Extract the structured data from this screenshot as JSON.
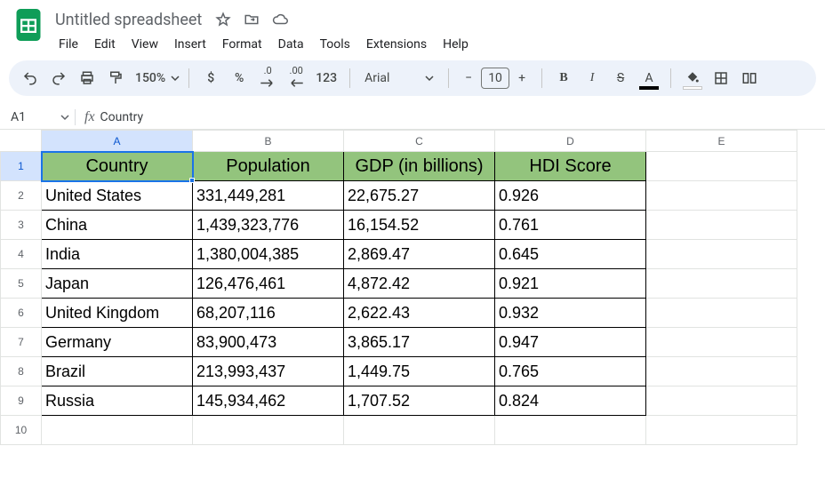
{
  "header": {
    "doc_title": "Untitled spreadsheet",
    "star_icon": "star-outline",
    "move_icon": "folder-move",
    "cloud_icon": "cloud-check"
  },
  "menubar": [
    "File",
    "Edit",
    "View",
    "Insert",
    "Format",
    "Data",
    "Tools",
    "Extensions",
    "Help"
  ],
  "toolbar": {
    "zoom": "150%",
    "currency": "$",
    "percent": "%",
    "dec_decrease": ".0",
    "dec_increase": ".00",
    "more_formats": "123",
    "font_name": "Arial",
    "font_size": "10",
    "text_color_underline": "#000000",
    "fill_color_underline": "#ffffff"
  },
  "name_box": {
    "ref": "A1",
    "formula": "Country"
  },
  "columns": [
    "A",
    "B",
    "C",
    "D",
    "E"
  ],
  "row_numbers": [
    "1",
    "2",
    "3",
    "4",
    "5",
    "6",
    "7",
    "8",
    "9",
    "10"
  ],
  "table": {
    "headers": [
      "Country",
      "Population",
      "GDP (in billions)",
      "HDI Score"
    ],
    "rows": [
      [
        "United States",
        "331,449,281",
        "22,675.27",
        "0.926"
      ],
      [
        "China",
        "1,439,323,776",
        "16,154.52",
        "0.761"
      ],
      [
        "India",
        "1,380,004,385",
        "2,869.47",
        "0.645"
      ],
      [
        "Japan",
        "126,476,461",
        "4,872.42",
        "0.921"
      ],
      [
        "United Kingdom",
        "68,207,116",
        "2,622.43",
        "0.932"
      ],
      [
        "Germany",
        "83,900,473",
        "3,865.17",
        "0.947"
      ],
      [
        "Brazil",
        "213,993,437",
        "1,449.75",
        "0.765"
      ],
      [
        "Russia",
        "145,934,462",
        "1,707.52",
        "0.824"
      ]
    ]
  },
  "active_cell": "A1"
}
